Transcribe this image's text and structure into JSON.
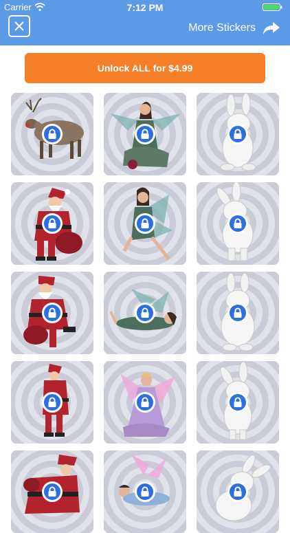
{
  "status_bar": {
    "carrier": "Carrier",
    "time": "7:12 PM"
  },
  "nav": {
    "more_label": "More Stickers",
    "close_icon": "close-icon",
    "share_icon": "share-arrow-icon"
  },
  "unlock": {
    "label": "Unlock ALL for $4.99"
  },
  "colors": {
    "nav": "#5b9be6",
    "unlock": "#f57f29",
    "lock": "#2e6fe0",
    "ring_dark": "#c9ccd6",
    "ring_light": "#dfe2e9"
  },
  "stickers": [
    {
      "subject": "reindeer",
      "locked": true
    },
    {
      "subject": "fairy",
      "locked": true
    },
    {
      "subject": "easter-bunny",
      "locked": true
    },
    {
      "subject": "santa",
      "locked": true
    },
    {
      "subject": "fairy",
      "locked": true
    },
    {
      "subject": "easter-bunny",
      "locked": true
    },
    {
      "subject": "santa",
      "locked": true
    },
    {
      "subject": "fairy",
      "locked": true
    },
    {
      "subject": "easter-bunny",
      "locked": true
    },
    {
      "subject": "santa",
      "locked": true
    },
    {
      "subject": "fairy",
      "locked": true
    },
    {
      "subject": "easter-bunny",
      "locked": true
    },
    {
      "subject": "santa",
      "locked": true
    },
    {
      "subject": "fairy",
      "locked": true
    },
    {
      "subject": "easter-bunny",
      "locked": true
    }
  ]
}
